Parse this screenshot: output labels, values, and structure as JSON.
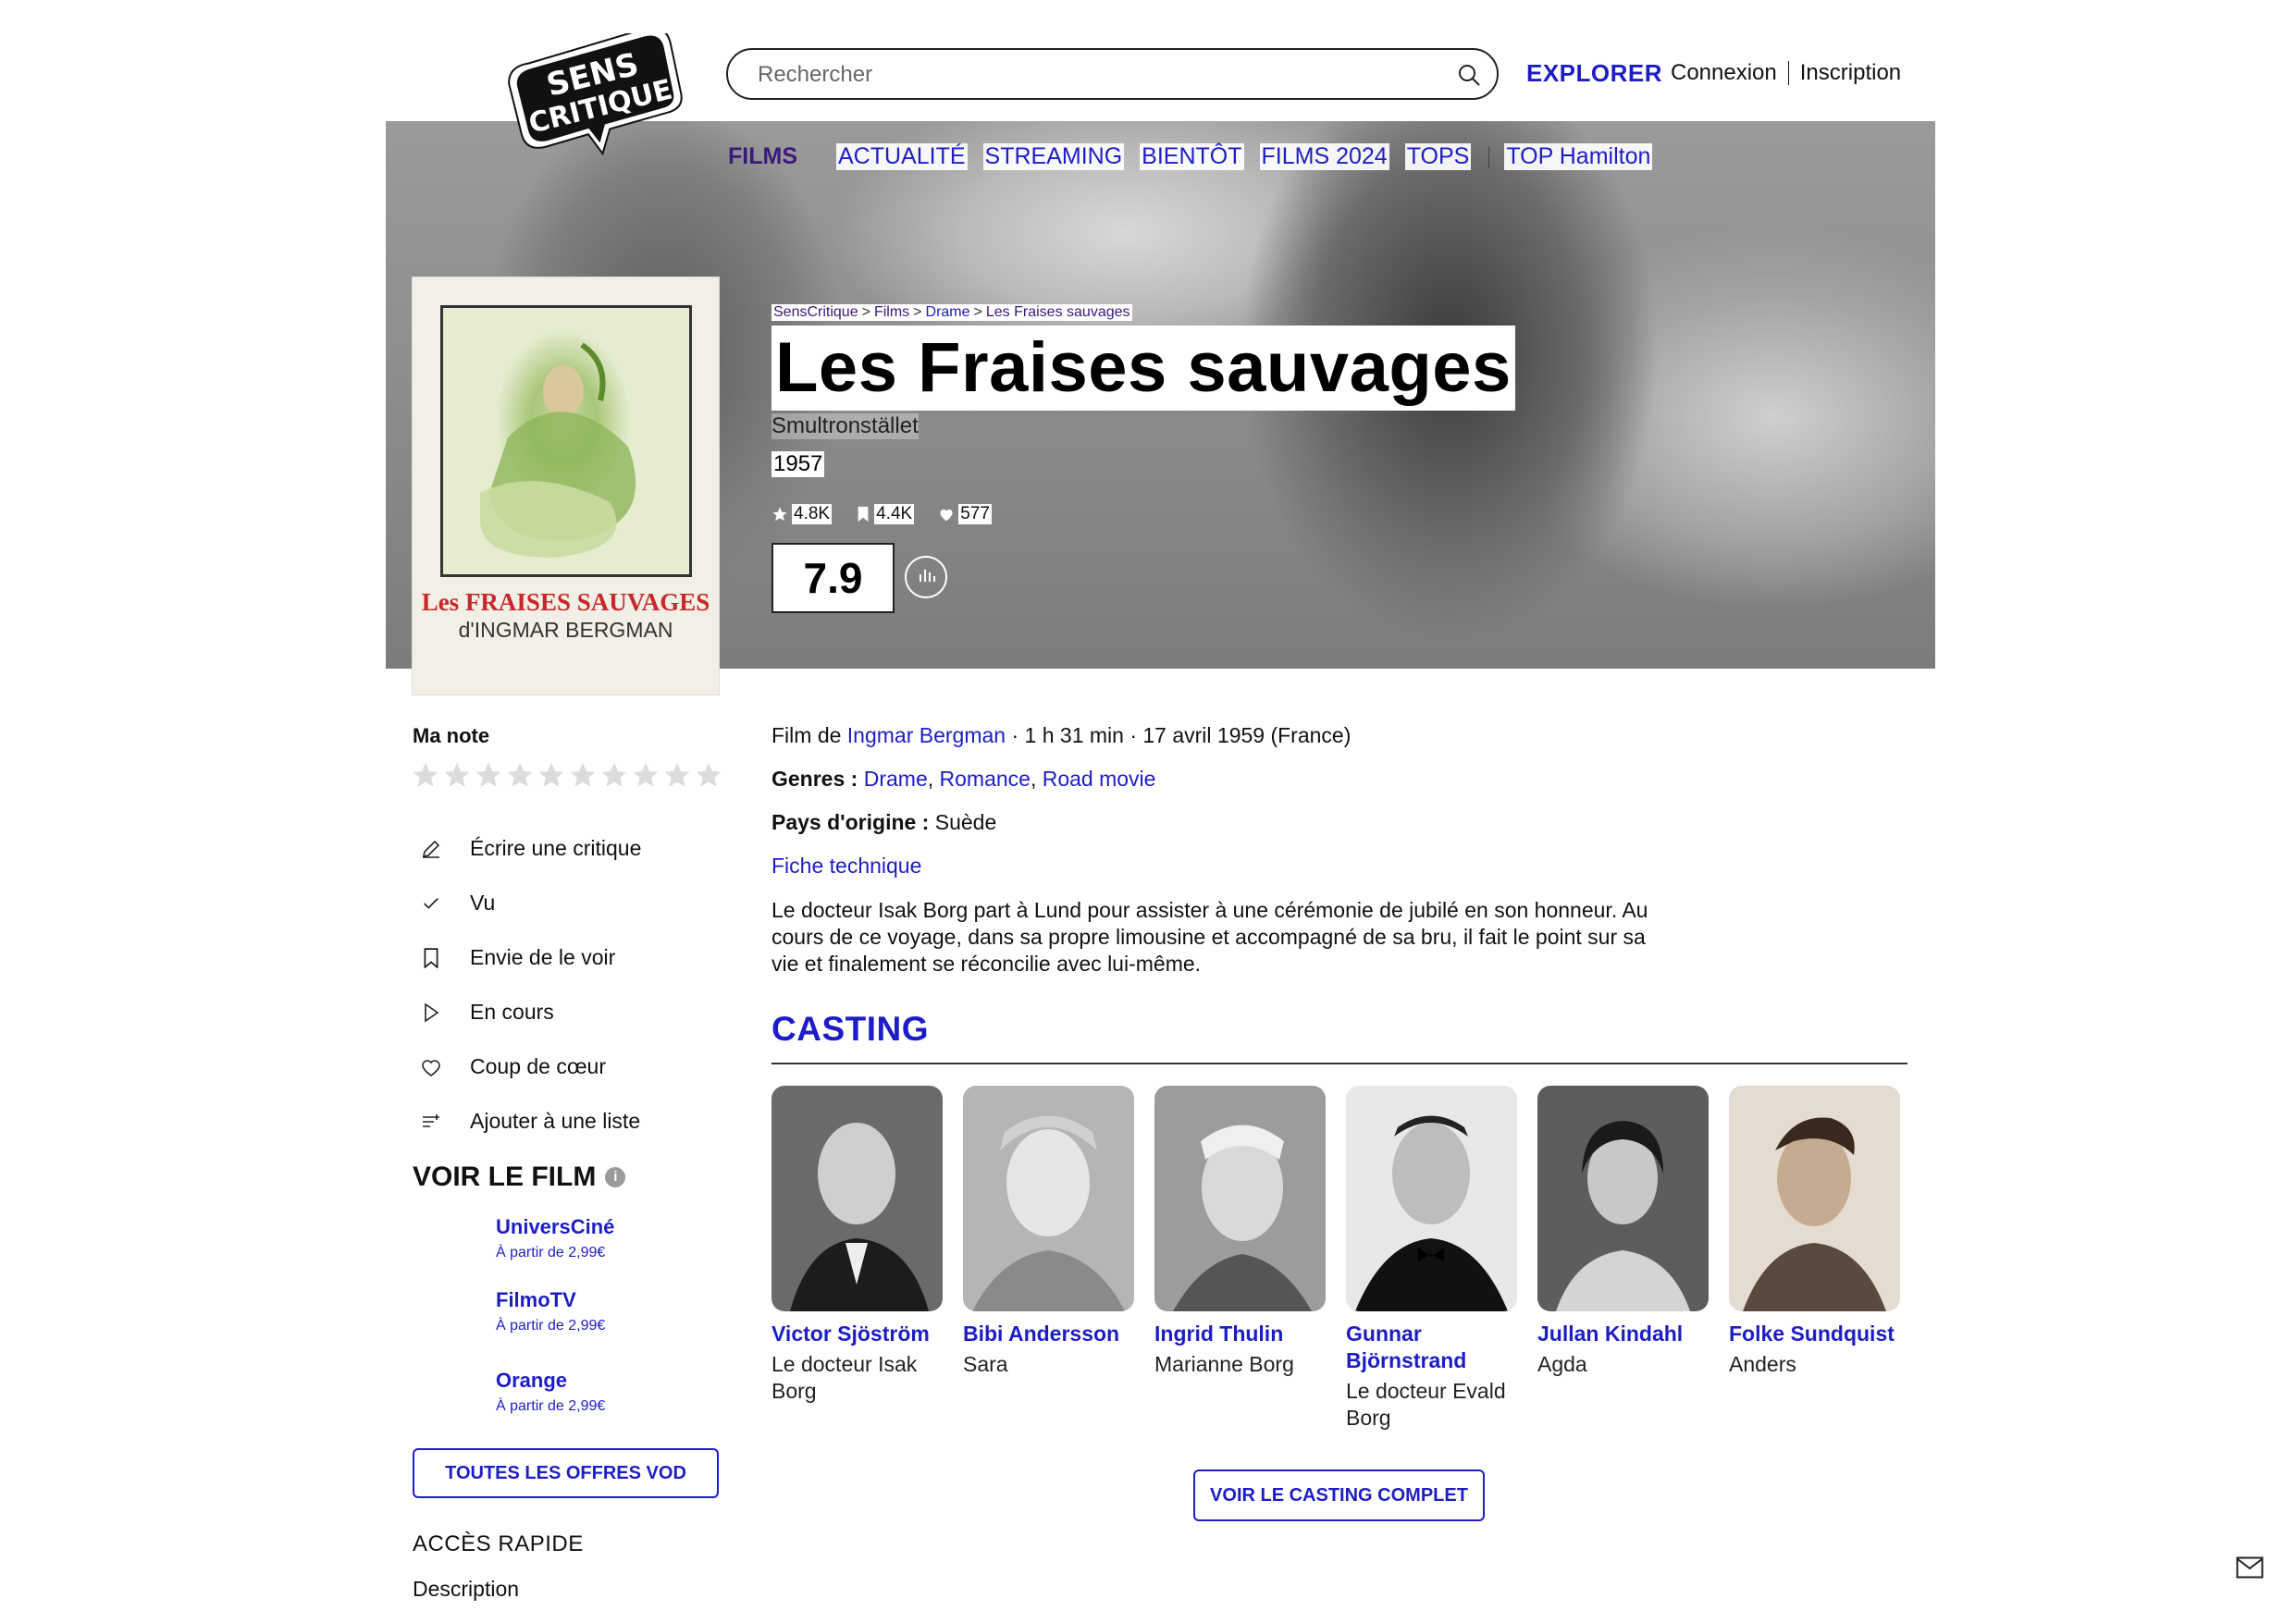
{
  "header": {
    "logo_alt": "SensCritique",
    "logo_line1": "SENS",
    "logo_line2": "CRITIQUE",
    "search_placeholder": "Rechercher",
    "explore": "EXPLORER",
    "login": "Connexion",
    "signup": "Inscription"
  },
  "nav": {
    "items": [
      "FILMS",
      "ACTUALITÉ",
      "STREAMING",
      "BIENTÔT",
      "FILMS 2024",
      "TOPS",
      "TOP Hamilton"
    ]
  },
  "poster": {
    "title_line": "Les FRAISES SAUVAGES",
    "director_line": "d'INGMAR BERGMAN"
  },
  "breadcrumb": [
    "SensCritique",
    "Films",
    "Drame",
    "Les Fraises sauvages"
  ],
  "film": {
    "title": "Les Fraises sauvages",
    "original_title": "Smultronstället",
    "year": "1957",
    "stats": {
      "ratings": "4.8K",
      "wishlist": "4.4K",
      "favorites": "577"
    },
    "score": "7.9",
    "info_prefix": "Film de",
    "director": "Ingmar Bergman",
    "info_suffix": "· 1 h 31 min · 17 avril 1959 (France)",
    "genres_label": "Genres :",
    "genres": [
      "Drame",
      "Romance",
      "Road movie"
    ],
    "country_label": "Pays d'origine :",
    "country": "Suède",
    "tech_sheet": "Fiche technique",
    "synopsis": "Le docteur Isak Borg part à Lund pour assister à une cérémonie de jubilé en son honneur. Au cours de ce voyage, dans sa propre limousine et accompagné de sa bru, il fait le point sur sa vie et finalement se réconcilie avec lui-même."
  },
  "sidebar": {
    "my_rating": "Ma note",
    "actions": [
      {
        "label": "Écrire une critique",
        "icon": "pencil-icon"
      },
      {
        "label": "Vu",
        "icon": "check-icon"
      },
      {
        "label": "Envie de le voir",
        "icon": "bookmark-icon"
      },
      {
        "label": "En cours",
        "icon": "play-icon"
      },
      {
        "label": "Coup de cœur",
        "icon": "heart-icon"
      },
      {
        "label": "Ajouter à une liste",
        "icon": "list-add-icon"
      }
    ],
    "watch_title": "VOIR LE FILM",
    "vod": [
      {
        "name": "UniversCiné",
        "price": "À partir de 2,99€"
      },
      {
        "name": "FilmoTV",
        "price": "À partir de 2,99€"
      },
      {
        "name": "Orange",
        "price": "À partir de 2,99€"
      }
    ],
    "all_vod": "TOUTES LES OFFRES VOD",
    "quick_access": "ACCÈS RAPIDE",
    "quick_links": [
      "Description"
    ]
  },
  "casting": {
    "title": "CASTING",
    "actors": [
      {
        "name": "Victor Sjöström",
        "role": "Le docteur Isak Borg"
      },
      {
        "name": "Bibi Andersson",
        "role": "Sara"
      },
      {
        "name": "Ingrid Thulin",
        "role": "Marianne Borg"
      },
      {
        "name": "Gunnar Björnstrand",
        "role": "Le docteur Evald Borg"
      },
      {
        "name": "Jullan Kindahl",
        "role": "Agda"
      },
      {
        "name": "Folke Sundquist",
        "role": "Anders"
      }
    ],
    "full_cast_button": "VOIR LE CASTING COMPLET"
  },
  "colors": {
    "link_blue": "#1d1dc7",
    "active_nav_purple": "#3a1a7a",
    "text": "#111111"
  }
}
